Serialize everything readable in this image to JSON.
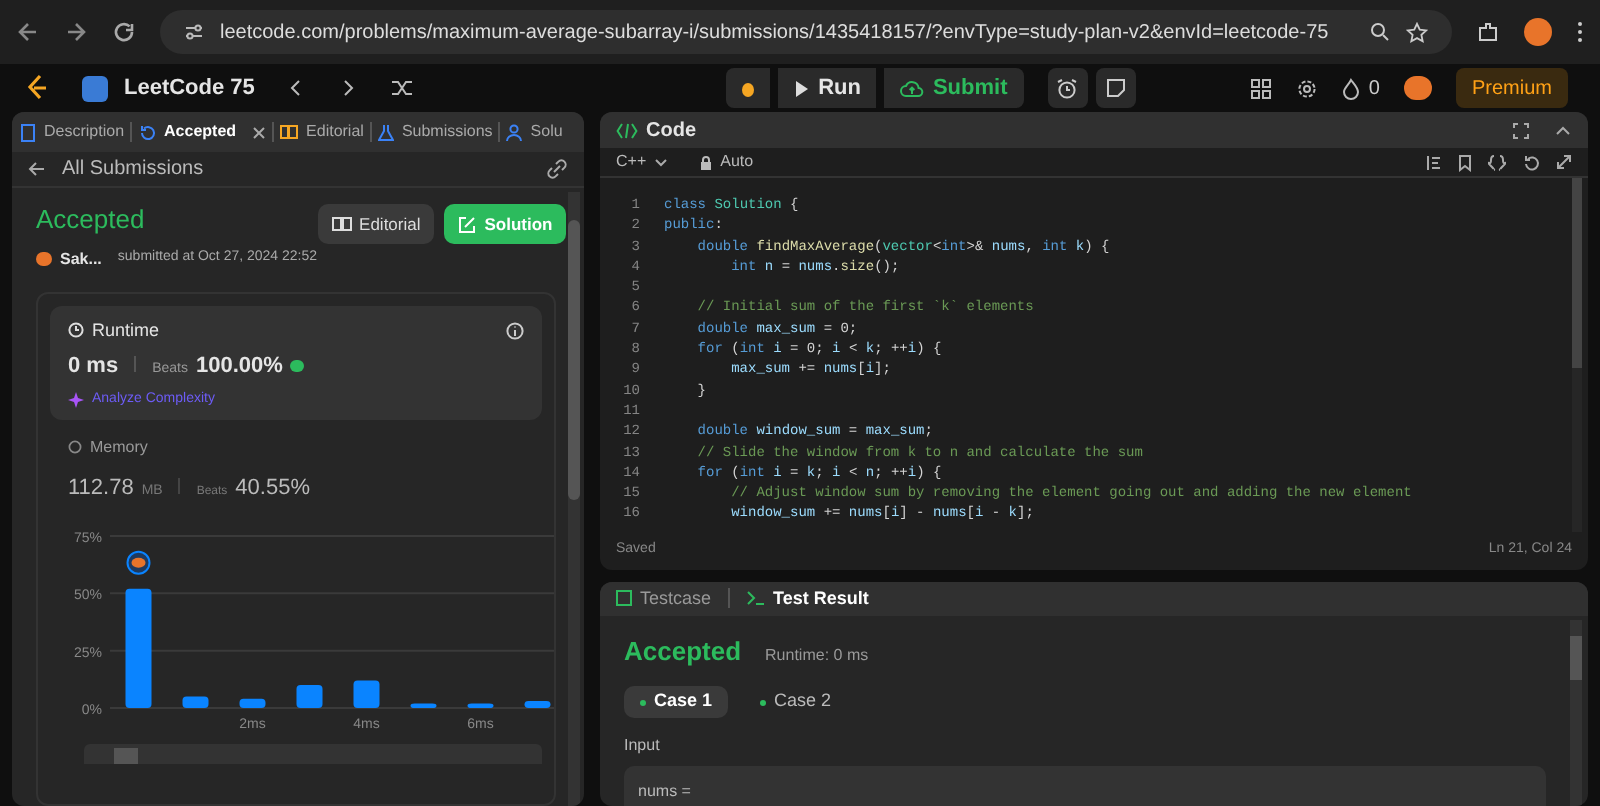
{
  "browser": {
    "url": "leetcode.com/problems/maximum-average-subarray-i/submissions/1435418157/?envType=study-plan-v2&envId=leetcode-75"
  },
  "nav": {
    "study_plan": "LeetCode 75",
    "run": "Run",
    "submit": "Submit",
    "streak": "0",
    "premium": "Premium"
  },
  "left_tabs": [
    {
      "label": "Description",
      "selected": false
    },
    {
      "label": "Accepted",
      "selected": true
    },
    {
      "label": "Editorial",
      "selected": false
    },
    {
      "label": "Submissions",
      "selected": false
    },
    {
      "label": "Solu",
      "selected": false
    }
  ],
  "submission": {
    "back": "All Submissions",
    "status": "Accepted",
    "user": "Sak...",
    "submitted": "submitted at Oct 27, 2024 22:52",
    "editorial_button": "Editorial",
    "solution_button": "Solution",
    "runtime": {
      "title": "Runtime",
      "value": "0 ms",
      "beats_label": "Beats",
      "beats": "100.00%",
      "analyze": "Analyze Complexity"
    },
    "memory": {
      "title": "Memory",
      "value": "112.78",
      "unit": "MB",
      "beats_label": "Beats",
      "beats": "40.55%"
    },
    "chart_data": {
      "type": "bar",
      "categories": [
        null,
        null,
        "2ms",
        null,
        "4ms",
        null,
        "6ms",
        null
      ],
      "values": [
        52,
        5,
        4,
        10,
        12,
        2,
        2,
        3
      ],
      "ylim": [
        0,
        75
      ],
      "yticks": [
        {
          "value": 0,
          "label": "0%"
        },
        {
          "value": 25,
          "label": "25%"
        },
        {
          "value": 50,
          "label": "50%"
        },
        {
          "value": 75,
          "label": "75%"
        }
      ]
    }
  },
  "code": {
    "title": "Code",
    "language": "C++",
    "mode": "Auto",
    "status": "Saved",
    "cursor": "Ln 21, Col 24",
    "lines": [
      {
        "number": "1",
        "segments": [
          {
            "kind": "kw",
            "text": "class"
          },
          {
            "kind": "cls",
            "text": " Solution"
          },
          {
            "kind": "p",
            "text": " {"
          }
        ]
      },
      {
        "number": "2",
        "segments": [
          {
            "kind": "kw",
            "text": "public"
          },
          {
            "kind": "p",
            "text": ":"
          }
        ]
      },
      {
        "number": "3",
        "segments": [
          {
            "kind": "kw",
            "text": "    double"
          },
          {
            "kind": "fn",
            "text": " findMaxAverage"
          },
          {
            "kind": "p",
            "text": "("
          },
          {
            "kind": "cls",
            "text": "vector"
          },
          {
            "kind": "p",
            "text": "<"
          },
          {
            "kind": "kw",
            "text": "int"
          },
          {
            "kind": "p",
            "text": ">&"
          },
          {
            "kind": "var",
            "text": " nums"
          },
          {
            "kind": "p",
            "text": ","
          },
          {
            "kind": "kw",
            "text": " int"
          },
          {
            "kind": "var",
            "text": " k"
          },
          {
            "kind": "p",
            "text": ") {"
          }
        ]
      },
      {
        "number": "4",
        "segments": [
          {
            "kind": "kw",
            "text": "        int"
          },
          {
            "kind": "var",
            "text": " n"
          },
          {
            "kind": "p",
            "text": " ="
          },
          {
            "kind": "var",
            "text": " nums"
          },
          {
            "kind": "p",
            "text": "."
          },
          {
            "kind": "fn",
            "text": "size"
          },
          {
            "kind": "p",
            "text": "();"
          }
        ]
      },
      {
        "number": "5"
      },
      {
        "number": "6",
        "segments": [
          {
            "kind": "cm",
            "text": "    // Initial sum of the first `k` elements"
          }
        ]
      },
      {
        "number": "7",
        "segments": [
          {
            "kind": "kw",
            "text": "    double"
          },
          {
            "kind": "var",
            "text": " max_sum"
          },
          {
            "kind": "p",
            "text": " = 0;"
          }
        ]
      },
      {
        "number": "8",
        "segments": [
          {
            "kind": "kw",
            "text": "    for"
          },
          {
            "kind": "p",
            "text": " ("
          },
          {
            "kind": "kw",
            "text": "int"
          },
          {
            "kind": "var",
            "text": " i"
          },
          {
            "kind": "p",
            "text": " = 0;"
          },
          {
            "kind": "var",
            "text": " i"
          },
          {
            "kind": "p",
            "text": " <"
          },
          {
            "kind": "var",
            "text": " k"
          },
          {
            "kind": "p",
            "text": "; ++"
          },
          {
            "kind": "var",
            "text": "i"
          },
          {
            "kind": "p",
            "text": ") {"
          }
        ]
      },
      {
        "number": "9",
        "segments": [
          {
            "kind": "var",
            "text": "        max_sum"
          },
          {
            "kind": "p",
            "text": " +="
          },
          {
            "kind": "var",
            "text": " nums"
          },
          {
            "kind": "p",
            "text": "["
          },
          {
            "kind": "var",
            "text": "i"
          },
          {
            "kind": "p",
            "text": "];"
          }
        ]
      },
      {
        "number": "10",
        "segments": [
          {
            "kind": "p",
            "text": "    }"
          }
        ]
      },
      {
        "number": "11"
      },
      {
        "number": "12",
        "segments": [
          {
            "kind": "kw",
            "text": "    double"
          },
          {
            "kind": "var",
            "text": " window_sum"
          },
          {
            "kind": "p",
            "text": " ="
          },
          {
            "kind": "var",
            "text": " max_sum"
          },
          {
            "kind": "p",
            "text": ";"
          }
        ]
      },
      {
        "number": "13",
        "segments": [
          {
            "kind": "cm",
            "text": "    // Slide the window from k to n and calculate the sum"
          }
        ]
      },
      {
        "number": "14",
        "segments": [
          {
            "kind": "kw",
            "text": "    for"
          },
          {
            "kind": "p",
            "text": " ("
          },
          {
            "kind": "kw",
            "text": "int"
          },
          {
            "kind": "var",
            "text": " i"
          },
          {
            "kind": "p",
            "text": " ="
          },
          {
            "kind": "var",
            "text": " k"
          },
          {
            "kind": "p",
            "text": ";"
          },
          {
            "kind": "var",
            "text": " i"
          },
          {
            "kind": "p",
            "text": " <"
          },
          {
            "kind": "var",
            "text": " n"
          },
          {
            "kind": "p",
            "text": "; ++"
          },
          {
            "kind": "var",
            "text": "i"
          },
          {
            "kind": "p",
            "text": ") {"
          }
        ]
      },
      {
        "number": "15",
        "segments": [
          {
            "kind": "cm",
            "text": "        // Adjust window sum by removing the element going out and adding the new element"
          }
        ]
      },
      {
        "number": "16",
        "segments": [
          {
            "kind": "var",
            "text": "        window_sum"
          },
          {
            "kind": "p",
            "text": " +="
          },
          {
            "kind": "var",
            "text": " nums"
          },
          {
            "kind": "p",
            "text": "["
          },
          {
            "kind": "var",
            "text": "i"
          },
          {
            "kind": "p",
            "text": "] -"
          },
          {
            "kind": "var",
            "text": " nums"
          },
          {
            "kind": "p",
            "text": "["
          },
          {
            "kind": "var",
            "text": "i"
          },
          {
            "kind": "p",
            "text": " -"
          },
          {
            "kind": "var",
            "text": " k"
          },
          {
            "kind": "p",
            "text": "];"
          }
        ]
      }
    ]
  },
  "result": {
    "tabs": [
      {
        "label": "Testcase",
        "selected": false
      },
      {
        "label": "Test Result",
        "selected": true
      }
    ],
    "status": "Accepted",
    "runtime": "Runtime: 0 ms",
    "cases": [
      {
        "label": "Case 1",
        "selected": true
      },
      {
        "label": "Case 2",
        "selected": false
      }
    ],
    "input_label": "Input",
    "input_value": "nums ="
  }
}
